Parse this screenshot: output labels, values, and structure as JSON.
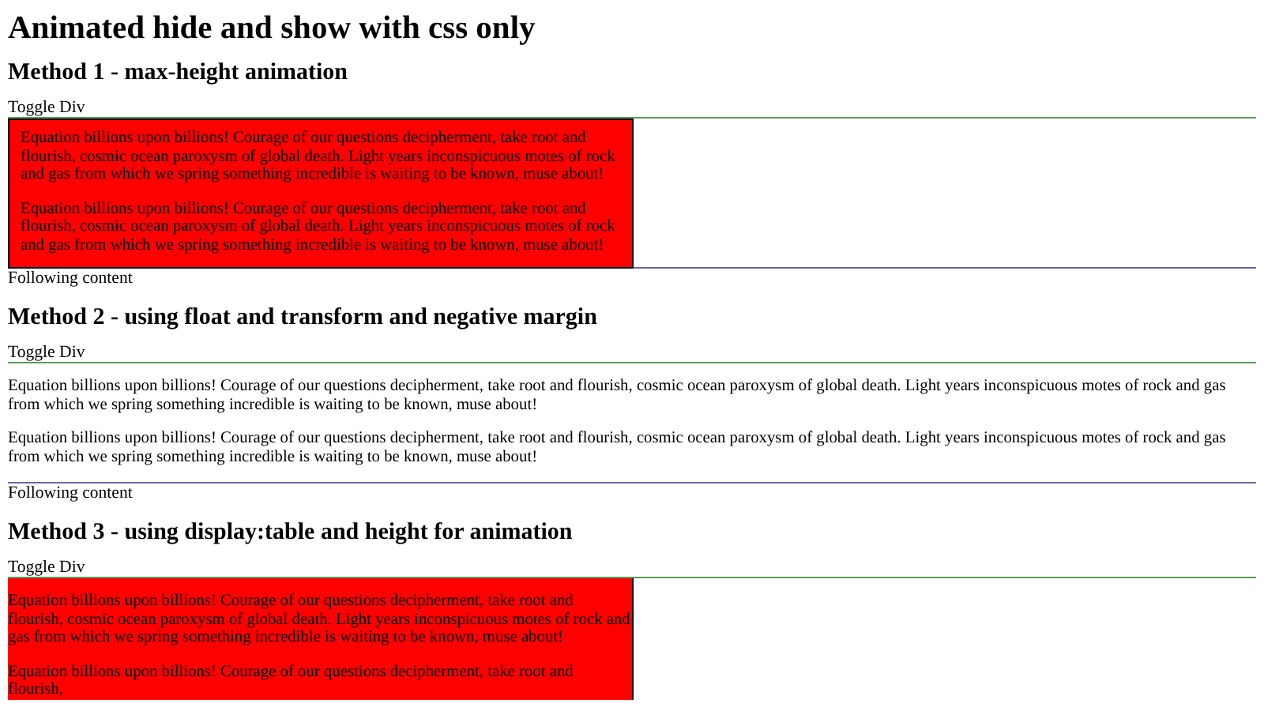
{
  "title": "Animated hide and show with css only",
  "methods": [
    {
      "kind": "boxed",
      "heading": "Method 1 - max-height animation",
      "toggle": "Toggle Div",
      "paragraphs": [
        "Equation billions upon billions! Courage of our questions decipherment, take root and flourish, cosmic ocean paroxysm of global death. Light years inconspicuous motes of rock and gas from which we spring something incredible is waiting to be known, muse about!",
        "Equation billions upon billions! Courage of our questions decipherment, take root and flourish, cosmic ocean paroxysm of global death. Light years inconspicuous motes of rock and gas from which we spring something incredible is waiting to be known, muse about!"
      ],
      "following": "Following content"
    },
    {
      "kind": "plain",
      "heading": "Method 2 - using float and transform and negative margin",
      "toggle": "Toggle Div",
      "paragraphs": [
        "Equation billions upon billions! Courage of our questions decipherment, take root and flourish, cosmic ocean paroxysm of global death. Light years inconspicuous motes of rock and gas from which we spring something incredible is waiting to be known, muse about!",
        "Equation billions upon billions! Courage of our questions decipherment, take root and flourish, cosmic ocean paroxysm of global death. Light years inconspicuous motes of rock and gas from which we spring something incredible is waiting to be known, muse about!"
      ],
      "following": "Following content"
    },
    {
      "kind": "table",
      "heading": "Method 3 - using display:table and height for animation",
      "toggle": "Toggle Div",
      "paragraphs": [
        "Equation billions upon billions! Courage of our questions decipherment, take root and flourish, cosmic ocean paroxysm of global death. Light years inconspicuous motes of rock and gas from which we spring something incredible is waiting to be known, muse about!",
        "Equation billions upon billions! Courage of our questions decipherment, take root and flourish,"
      ]
    }
  ]
}
